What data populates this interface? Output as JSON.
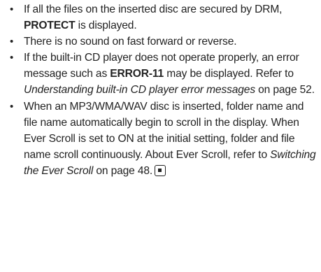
{
  "notes": [
    {
      "pre": "If all the files on the inserted disc are secured by DRM, ",
      "bold": "PROTECT",
      "post": " is displayed."
    },
    {
      "text": "There is no sound on fast forward or reverse."
    },
    {
      "pre": "If the built-in CD player does not operate properly, an error message such as ",
      "bold": "ERROR-11",
      "mid": " may be displayed. Refer to ",
      "italic": "Understanding built-in CD player error messages",
      "post": " on page 52."
    },
    {
      "text": "When an MP3/WMA/WAV disc is inserted, folder name and file name automatically begin to scroll in the display. When Ever Scroll is set to ON at the initial setting, folder and file name scroll continuously. About Ever Scroll, refer to ",
      "italic": "Switching the Ever Scroll",
      "post": " on page 48."
    }
  ],
  "bullet_char": "•",
  "end_mark_icon": "end-of-section-icon"
}
